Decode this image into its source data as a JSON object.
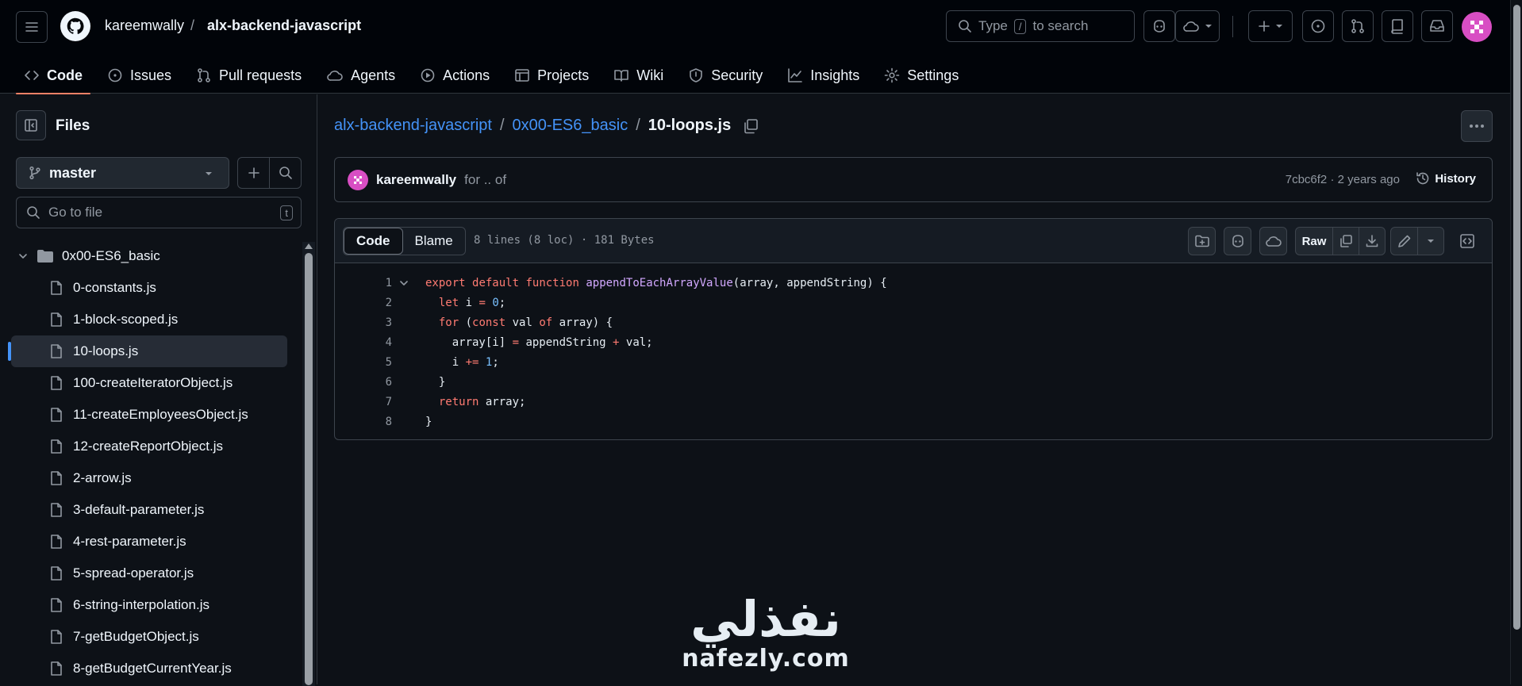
{
  "header": {
    "owner": "kareemwally",
    "separator": "/",
    "repo": "alx-backend-javascript",
    "search": {
      "prefix": "Type",
      "key": "/",
      "suffix": "to search"
    }
  },
  "repo_nav": [
    {
      "label": "Code",
      "icon": "code-icon",
      "active": true
    },
    {
      "label": "Issues",
      "icon": "issue-icon"
    },
    {
      "label": "Pull requests",
      "icon": "pull-request-icon"
    },
    {
      "label": "Agents",
      "icon": "agent-icon"
    },
    {
      "label": "Actions",
      "icon": "play-icon"
    },
    {
      "label": "Projects",
      "icon": "table-icon"
    },
    {
      "label": "Wiki",
      "icon": "book-icon"
    },
    {
      "label": "Security",
      "icon": "shield-icon"
    },
    {
      "label": "Insights",
      "icon": "graph-icon"
    },
    {
      "label": "Settings",
      "icon": "gear-icon"
    }
  ],
  "sidebar": {
    "title": "Files",
    "branch": "master",
    "goto_placeholder": "Go to file",
    "goto_key": "t",
    "folder": "0x00-ES6_basic",
    "files": [
      "0-constants.js",
      "1-block-scoped.js",
      "10-loops.js",
      "100-createIteratorObject.js",
      "11-createEmployeesObject.js",
      "12-createReportObject.js",
      "2-arrow.js",
      "3-default-parameter.js",
      "4-rest-parameter.js",
      "5-spread-operator.js",
      "6-string-interpolation.js",
      "7-getBudgetObject.js",
      "8-getBudgetCurrentYear.js"
    ],
    "selected_file": "10-loops.js"
  },
  "breadcrumb": {
    "repo": "alx-backend-javascript",
    "folder": "0x00-ES6_basic",
    "file": "10-loops.js",
    "sep": "/"
  },
  "commit": {
    "author": "kareemwally",
    "message": "for .. of",
    "meta": "7cbc6f2 · 2 years ago",
    "history": "History"
  },
  "code_view": {
    "tab_code": "Code",
    "tab_blame": "Blame",
    "info": "8 lines (8 loc) · 181 Bytes",
    "raw": "Raw",
    "lines": [
      "export default function appendToEachArrayValue(array, appendString) {",
      "  let i = 0;",
      "  for (const val of array) {",
      "    array[i] = appendString + val;",
      "    i += 1;",
      "  }",
      "  return array;",
      "}"
    ]
  },
  "watermark": {
    "arabic": "نفذلي",
    "latin": "nafezly.com"
  },
  "colors": {
    "accent": "#4493f8",
    "tab_underline": "#f78166",
    "avatar": "#d84ec3",
    "bg": "#0d1117"
  }
}
